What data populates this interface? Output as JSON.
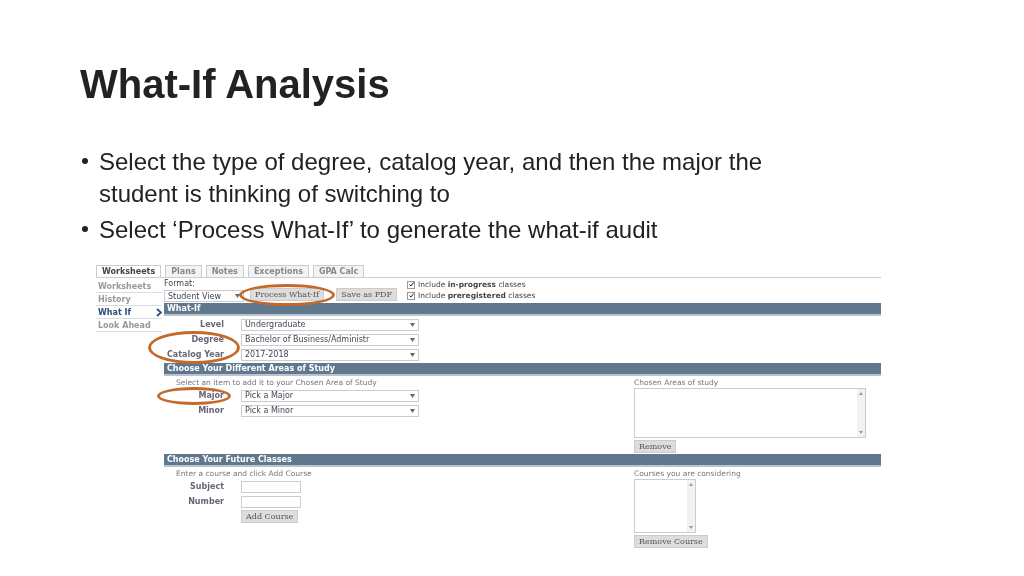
{
  "slide": {
    "title": "What-If Analysis",
    "bullets": [
      "Select the type of degree, catalog year, and then the major the student is thinking of switching to",
      "Select ‘Process What-If’ to generate the what-if audit"
    ]
  },
  "screenshot": {
    "tabs": [
      {
        "label": "Worksheets",
        "selected": true
      },
      {
        "label": "Plans",
        "selected": false
      },
      {
        "label": "Notes",
        "selected": false
      },
      {
        "label": "Exceptions",
        "selected": false
      },
      {
        "label": "GPA Calc",
        "selected": false
      }
    ],
    "nav": [
      {
        "label": "Worksheets",
        "selected": false
      },
      {
        "label": "History",
        "selected": false
      },
      {
        "label": "What If",
        "selected": true
      },
      {
        "label": "Look Ahead",
        "selected": false
      }
    ],
    "format": {
      "label": "Format:",
      "value": "Student View"
    },
    "buttons": [
      {
        "label": "Process What-If",
        "highlighted": true
      },
      {
        "label": "Save as PDF",
        "highlighted": false
      }
    ],
    "options": [
      {
        "label": "Include **in-progress** classes",
        "checked": true
      },
      {
        "label": "Include **preregistered** classes",
        "checked": true
      }
    ],
    "what_if": {
      "title": "What-If",
      "fields": [
        {
          "label": "Level",
          "value": "Undergraduate",
          "highlighted": false
        },
        {
          "label": "Degree",
          "value": "Bachelor of Business/Administr",
          "highlighted": true
        },
        {
          "label": "Catalog Year",
          "value": "2017-2018",
          "highlighted": true
        }
      ]
    },
    "areas": {
      "title": "Choose Your Different Areas of Study",
      "hint": "Select an item to add it to your Chosen Area of Study",
      "fields": [
        {
          "label": "Major",
          "value": "Pick a Major",
          "highlighted": true
        },
        {
          "label": "Minor",
          "value": "Pick a Minor",
          "highlighted": false
        }
      ],
      "list_label": "Chosen Areas of study",
      "button": "Remove"
    },
    "future": {
      "title": "Choose Your Future Classes",
      "hint": "Enter a course and click Add Course",
      "fields": [
        {
          "label": "Subject"
        },
        {
          "label": "Number"
        }
      ],
      "add_button": "Add Course",
      "list_label": "Courses you are considering",
      "button": "Remove Course"
    }
  }
}
